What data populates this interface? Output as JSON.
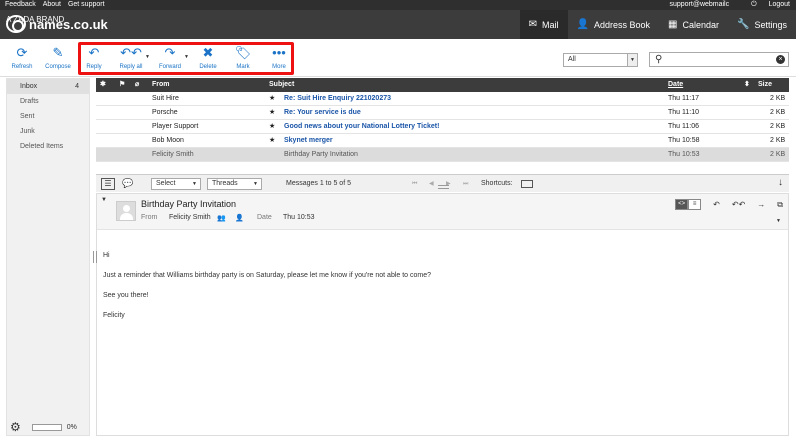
{
  "topbar": {
    "links": [
      "Feedback",
      "About",
      "Get support"
    ],
    "account": "support@webmailc",
    "logout": "Logout"
  },
  "brand": {
    "name": "names.co.uk",
    "tagline": "A ZADA BRAND"
  },
  "nav": [
    {
      "label": "Mail",
      "icon": "mail-icon",
      "active": true
    },
    {
      "label": "Address Book",
      "icon": "person-icon"
    },
    {
      "label": "Calendar",
      "icon": "calendar-icon"
    },
    {
      "label": "Settings",
      "icon": "wrench-icon"
    }
  ],
  "toolbar": {
    "refresh": "Refresh",
    "compose": "Compose",
    "reply": "Reply",
    "reply_all": "Reply all",
    "forward": "Forward",
    "delete": "Delete",
    "mark": "Mark",
    "more": "More"
  },
  "filter": {
    "value": "All"
  },
  "search": {
    "value": ""
  },
  "folders": [
    {
      "name": "Inbox",
      "count": "4",
      "active": true
    },
    {
      "name": "Drafts"
    },
    {
      "name": "Sent"
    },
    {
      "name": "Junk"
    },
    {
      "name": "Deleted Items"
    }
  ],
  "quota": {
    "percent": "0%",
    "fraction": 0
  },
  "list": {
    "columns": {
      "from": "From",
      "subject": "Subject",
      "date": "Date",
      "size": "Size"
    },
    "rows": [
      {
        "from": "Suit Hire",
        "subject": "Re: Suit Hire Enquiry 221020273",
        "date": "Thu 11:17",
        "size": "2 KB",
        "unread": true
      },
      {
        "from": "Porsche",
        "subject": "Re: Your service is due",
        "date": "Thu 11:10",
        "size": "2 KB",
        "unread": true
      },
      {
        "from": "Player Support",
        "subject": "Good news about your National Lottery Ticket!",
        "date": "Thu 11:06",
        "size": "2 KB",
        "unread": true
      },
      {
        "from": "Bob Moon",
        "subject": "Skynet merger",
        "date": "Thu 10:58",
        "size": "2 KB",
        "unread": true
      },
      {
        "from": "Felicity Smith",
        "subject": "Birthday Party Invitation",
        "date": "Thu 10:53",
        "size": "2 KB",
        "unread": false
      }
    ],
    "footer": {
      "select": "Select",
      "threads": "Threads",
      "count": "Messages 1 to 5 of 5",
      "shortcuts": "Shortcuts:"
    }
  },
  "preview": {
    "subject": "Birthday Party Invitation",
    "from_label": "From",
    "from": "Felicity Smith",
    "date_label": "Date",
    "date": "Thu 10:53",
    "body": [
      "Hi",
      "Just a reminder that Williams birthday party is on Saturday, please let me know if you're not able to come?",
      "See you there!",
      "Felicity"
    ]
  }
}
